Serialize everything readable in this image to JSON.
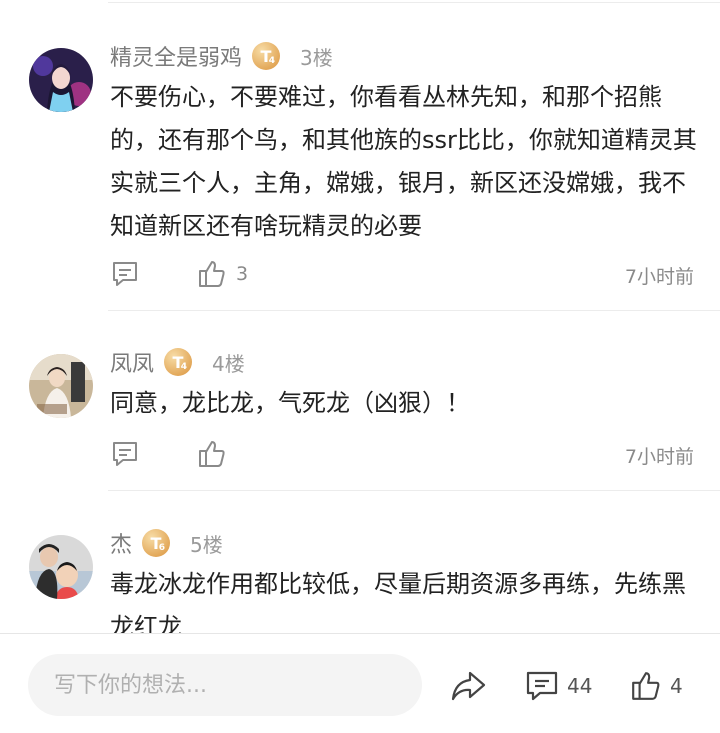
{
  "comments": [
    {
      "author": "精灵全是弱鸡",
      "level_letter": "T",
      "level_num": "4",
      "floor": "3楼",
      "text": "不要伤心，不要难过，你看看丛林先知，和那个招熊的，还有那个鸟，和其他族的ssr比比，你就知道精灵其实就三个人，主角，嫦娥，银月，新区还没嫦娥，我不知道新区还有啥玩精灵的必要",
      "likes": "3",
      "time": "7小时前"
    },
    {
      "author": "凤凤",
      "level_letter": "T",
      "level_num": "4",
      "floor": "4楼",
      "text": "同意，龙比龙，气死龙（凶狠）！",
      "likes": "",
      "time": "7小时前"
    },
    {
      "author": "杰",
      "level_letter": "T",
      "level_num": "6",
      "floor": "5楼",
      "text": "毒龙冰龙作用都比较低，尽量后期资源多再练，先练黑龙红龙",
      "likes": "",
      "time": ""
    }
  ],
  "bottom_bar": {
    "input_placeholder": "写下你的想法...",
    "comment_count": "44",
    "like_count": "4"
  },
  "colors": {
    "badge_gold": "#e3a95b",
    "meta_gray": "#8a8a8a",
    "text_dark": "#222222"
  }
}
